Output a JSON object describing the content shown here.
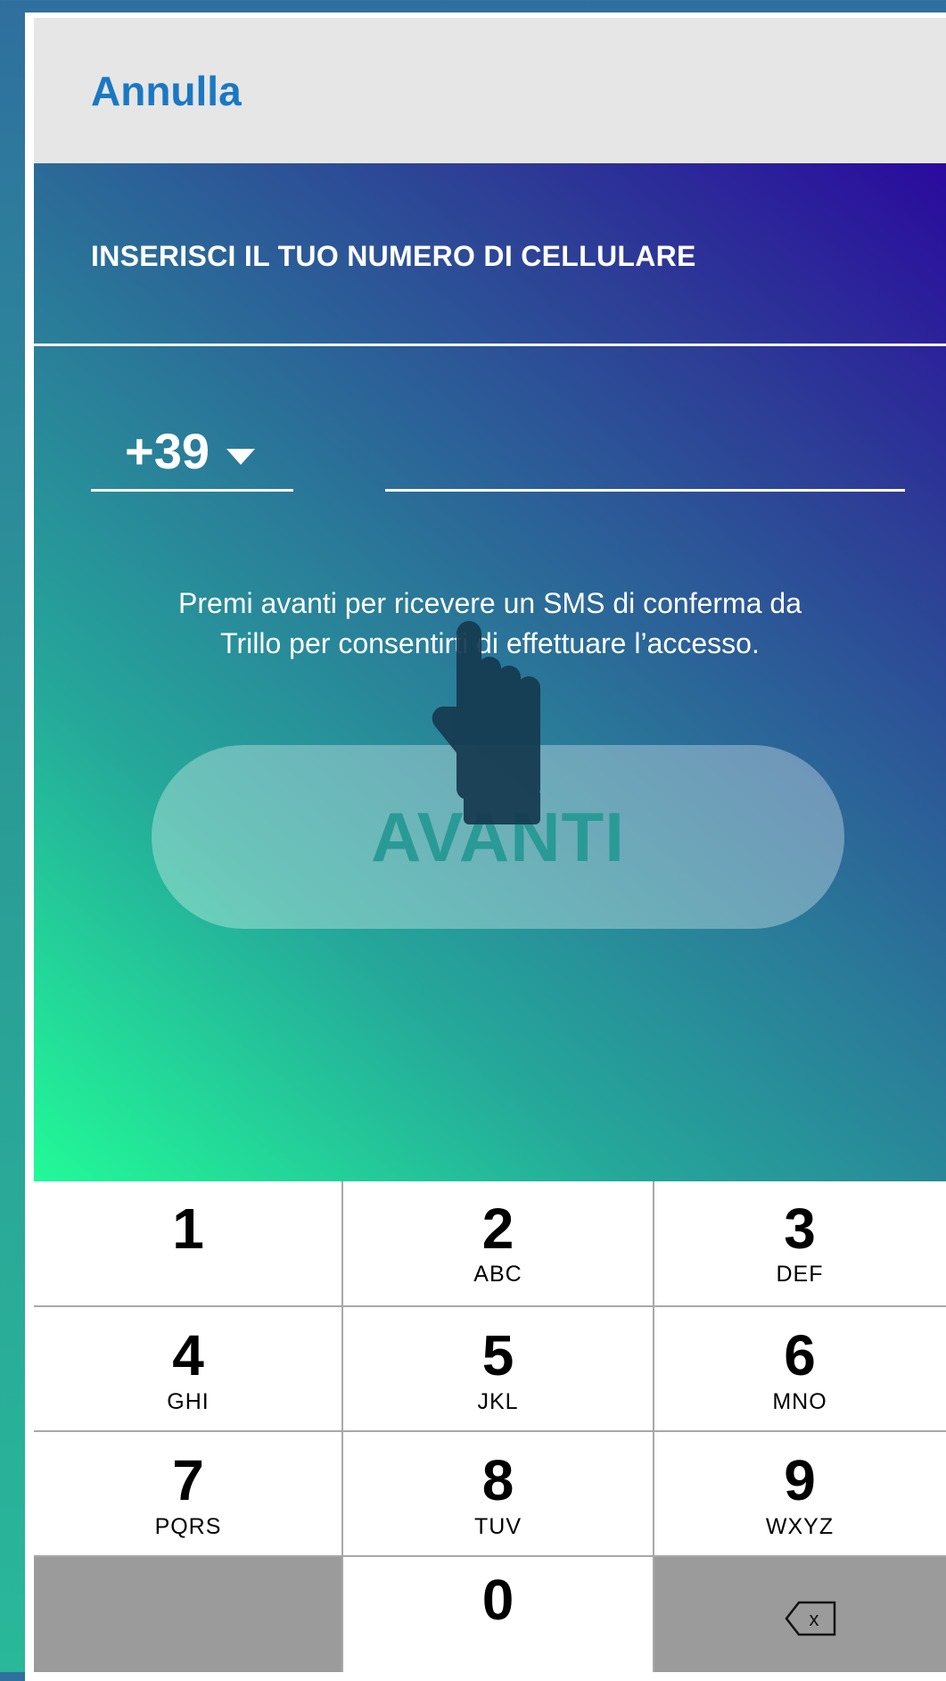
{
  "header": {
    "cancel_label": "Annulla"
  },
  "main": {
    "title": "INSERISCI IL TUO NUMERO DI CELLULARE",
    "country_code": "+39",
    "phone_value": "",
    "info_line1": "Premi avanti per ricevere un SMS di conferma da",
    "info_line2": "Trillo per consentirti di effettuare l’accesso.",
    "next_label": "AVANTI"
  },
  "keypad": {
    "keys": [
      {
        "num": "1",
        "letters": ""
      },
      {
        "num": "2",
        "letters": "ABC"
      },
      {
        "num": "3",
        "letters": "DEF"
      },
      {
        "num": "4",
        "letters": "GHI"
      },
      {
        "num": "5",
        "letters": "JKL"
      },
      {
        "num": "6",
        "letters": "MNO"
      },
      {
        "num": "7",
        "letters": "PQRS"
      },
      {
        "num": "8",
        "letters": "TUV"
      },
      {
        "num": "9",
        "letters": "WXYZ"
      },
      {
        "num": "0",
        "letters": ""
      }
    ],
    "backspace_glyph": "x"
  },
  "colors": {
    "accent": "#1a78c2",
    "header_bg": "#e6e6e6",
    "gradient_top": "#2a0a9e",
    "gradient_bottom": "#22fa98",
    "key_gray": "#9b9b9b"
  },
  "icons": [
    "chevron-down-icon",
    "hand-pointer-icon",
    "backspace-icon"
  ]
}
